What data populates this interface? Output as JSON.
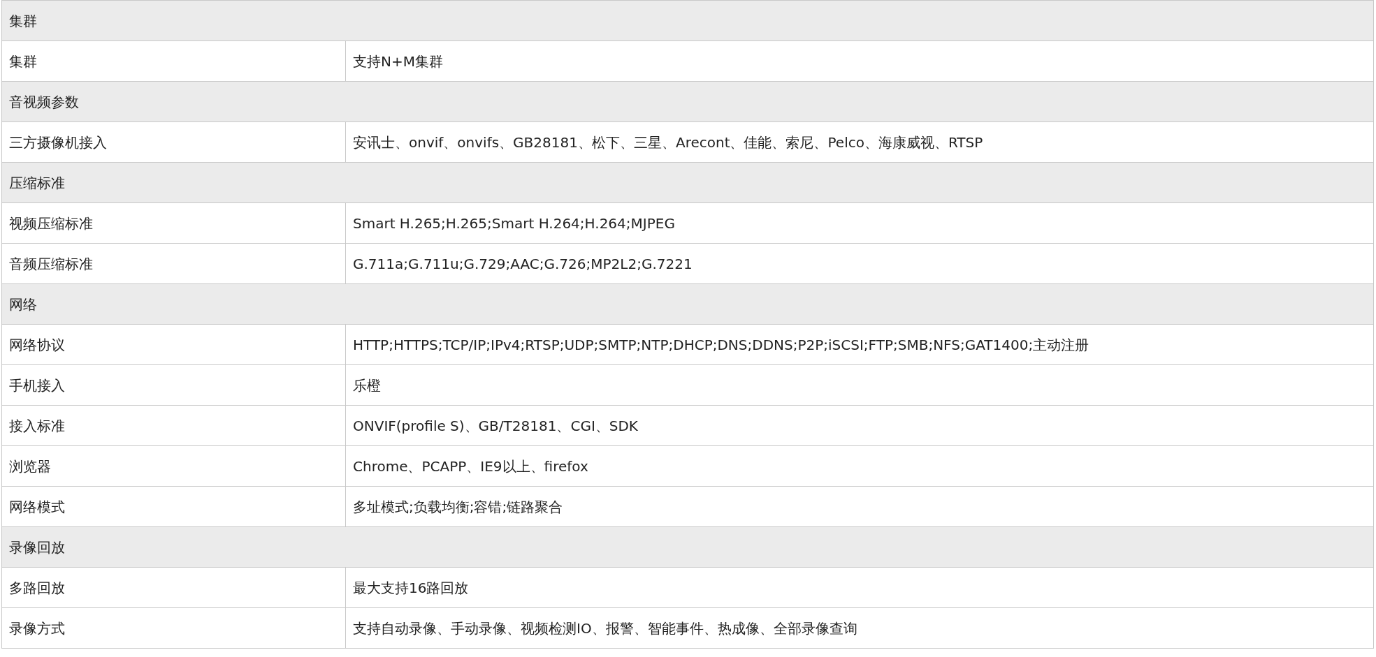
{
  "sections": [
    {
      "title": "集群",
      "rows": [
        {
          "label": "集群",
          "value": "支持N+M集群"
        }
      ]
    },
    {
      "title": "音视频参数",
      "rows": [
        {
          "label": "三方摄像机接入",
          "value": "安讯士、onvif、onvifs、GB28181、松下、三星、Arecont、佳能、索尼、Pelco、海康威视、RTSP"
        }
      ]
    },
    {
      "title": "压缩标准",
      "rows": [
        {
          "label": "视频压缩标准",
          "value": "Smart H.265;H.265;Smart H.264;H.264;MJPEG"
        },
        {
          "label": "音频压缩标准",
          "value": "G.711a;G.711u;G.729;AAC;G.726;MP2L2;G.7221"
        }
      ]
    },
    {
      "title": "网络",
      "rows": [
        {
          "label": "网络协议",
          "value": "HTTP;HTTPS;TCP/IP;IPv4;RTSP;UDP;SMTP;NTP;DHCP;DNS;DDNS;P2P;iSCSI;FTP;SMB;NFS;GAT1400;主动注册"
        },
        {
          "label": "手机接入",
          "value": "乐橙"
        },
        {
          "label": "接入标准",
          "value": "ONVIF(profile S)、GB/T28181、CGI、SDK"
        },
        {
          "label": "浏览器",
          "value": "Chrome、PCAPP、IE9以上、firefox"
        },
        {
          "label": "网络模式",
          "value": "多址模式;负载均衡;容错;链路聚合"
        }
      ]
    },
    {
      "title": "录像回放",
      "rows": [
        {
          "label": "多路回放",
          "value": "最大支持16路回放"
        },
        {
          "label": "录像方式",
          "value": "支持自动录像、手动录像、视频检测IO、报警、智能事件、热成像、全部录像查询"
        }
      ]
    }
  ]
}
